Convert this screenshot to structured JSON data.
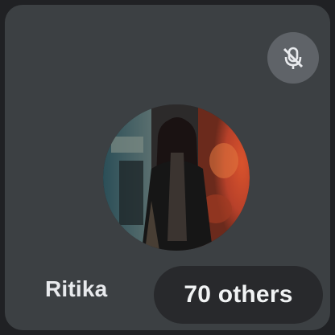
{
  "participant": {
    "name": "Ritika",
    "mic_state_icon": "mic-off-icon",
    "avatar": "profile-photo"
  },
  "overflow": {
    "label": "70 others"
  },
  "colors": {
    "tile_background": "#3c4043",
    "badge_background": "#5f6368",
    "pill_background": "#28292c",
    "text": "#e8eaed"
  }
}
